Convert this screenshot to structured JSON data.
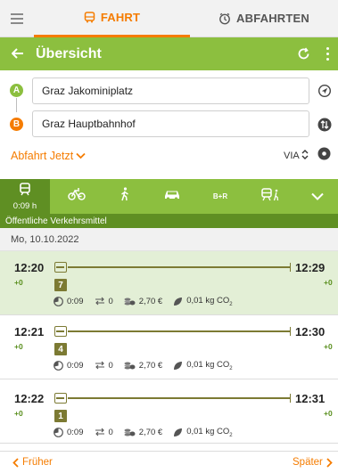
{
  "tabs": {
    "fahrt": "FAHRT",
    "abfahrten": "ABFAHRTEN"
  },
  "header": {
    "title": "Übersicht"
  },
  "route": {
    "from_badge": "A",
    "from": "Graz Jakominiplatz",
    "to_badge": "B",
    "to": "Graz Hauptbahnhof"
  },
  "options": {
    "time_mode": "Abfahrt Jetzt",
    "via": "VIA"
  },
  "modes": {
    "active_duration": "0:09 h",
    "bike_ride": "B+R",
    "active_label": "Öffentliche Verkehrsmittel"
  },
  "date": "Mo, 10.10.2022",
  "trips": [
    {
      "dep": "12:20",
      "dep_delay": "+0",
      "arr": "12:29",
      "arr_delay": "+0",
      "line": "7",
      "duration": "0:09",
      "transfers": "0",
      "price": "2,70 €",
      "co2": "0,01 kg CO",
      "co2_sub": "2"
    },
    {
      "dep": "12:21",
      "dep_delay": "+0",
      "arr": "12:30",
      "arr_delay": "+0",
      "line": "4",
      "duration": "0:09",
      "transfers": "0",
      "price": "2,70 €",
      "co2": "0,01 kg CO",
      "co2_sub": "2"
    },
    {
      "dep": "12:22",
      "dep_delay": "+0",
      "arr": "12:31",
      "arr_delay": "+0",
      "line": "1",
      "duration": "0:09",
      "transfers": "0",
      "price": "2,70 €",
      "co2": "0,01 kg CO",
      "co2_sub": "2"
    }
  ],
  "footer": {
    "earlier": "Früher",
    "later": "Später"
  },
  "colors": {
    "brand_green": "#8cbf3f",
    "dark_green": "#5f8f23",
    "accent_orange": "#f57c00",
    "line_olive": "#7c7a33"
  }
}
